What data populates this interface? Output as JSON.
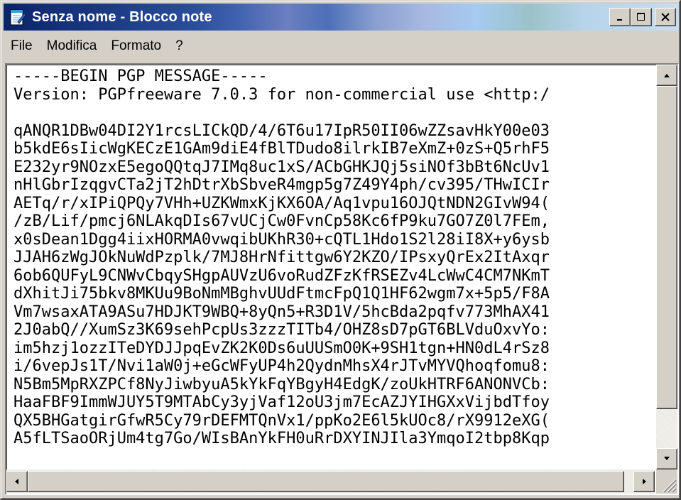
{
  "window": {
    "title": "Senza nome - Blocco note",
    "icon": "notepad-icon"
  },
  "caption_buttons": {
    "minimize": "_",
    "maximize": "□",
    "close": "×"
  },
  "menu": {
    "items": [
      {
        "label": "File"
      },
      {
        "label": "Modifica"
      },
      {
        "label": "Formato"
      },
      {
        "label": "?"
      }
    ]
  },
  "editor": {
    "lines": [
      "-----BEGIN PGP MESSAGE-----",
      "Version: PGPfreeware 7.0.3 for non-commercial use <http:/",
      "",
      "qANQR1DBw04DI2Y1rcsLICkQD/4/6T6u17IpR50II06wZZsavHkY00e03",
      "b5kdE6sIicWgKECzE1GAm9diE4fBlTDudo8ilrkIB7eXmZ+0zS+Q5rhF5",
      "E232yr9NOzxE5egoQQtqJ7IMq8uc1xS/ACbGHKJQj5siNOf3bBt6NcUv1",
      "nHlGbrIzqgvCTa2jT2hDtrXbSbveR4mgp5g7Z49Y4ph/cv395/THwICIr",
      "AETq/r/xIPiQPQy7VHh+UZKWmxKjKX6OA/Aq1vpu16OJQtNDN2GIvW94(",
      "/zB/Lif/pmcj6NLAkqDIs67vUCjCw0FvnCp58Kc6fP9ku7GO7Z0l7FEm,",
      "x0sDean1Dgg4iixHORMA0vwqibUKhR30+cQTL1Hdo1S2l28iI8X+y6ysb",
      "JJAH6zWgJOkNuWdPzplk/7MJ8HrNfittgw6Y2KZO/IPsxyQrEx2ItAxqr",
      "6ob6QUFyL9CNWvCbqySHgpAUVzU6voRudZFzKfRSEZv4LcWwC4CM7NKmT",
      "dXhitJi75bkv8MKUu9BoNmMBghvUUdFtmcFpQ1Q1HF62wgm7x+5p5/F8A",
      "Vm7wsaxATA9ASu7HDJKT9WBQ+8yQn5+R3D1V/5hcBda2pqfv773MhAX41",
      "2J0abQ//XumSz3K69sehPcpUs3zzzTITb4/OHZ8sD7pGT6BLVduOxvYo:",
      "im5hzj1ozzITeDYDJJpqEvZK2K0Ds6uUUSmO0K+9SH1tgn+HN0dL4rSz8",
      "i/6vepJs1T/Nvi1aW0j+eGcWFyUP4h2QydnMhsX4rJTvMYVQhoqfomu8:",
      "N5Bm5MpRXZPCf8NyJiwbyuA5kYkFqYBgyH4EdgK/zoUkHTRF6ANONVCb:",
      "HaaFBF9ImmWJUY5T9MTAbCy3yjVaf12oU3jm7EcAZJYIHGXxVijbdTfoy",
      "QX5BHGatgirGfwR5Cy79rDEFMTQnVx1/ppKo2E6l5kUOc8/rX9912eXG(",
      "A5fLTSaoORjUm4tg7Go/WIsBAnYkFH0uRrDXYINJIla3YmqoI2tbp8Kqp"
    ]
  }
}
